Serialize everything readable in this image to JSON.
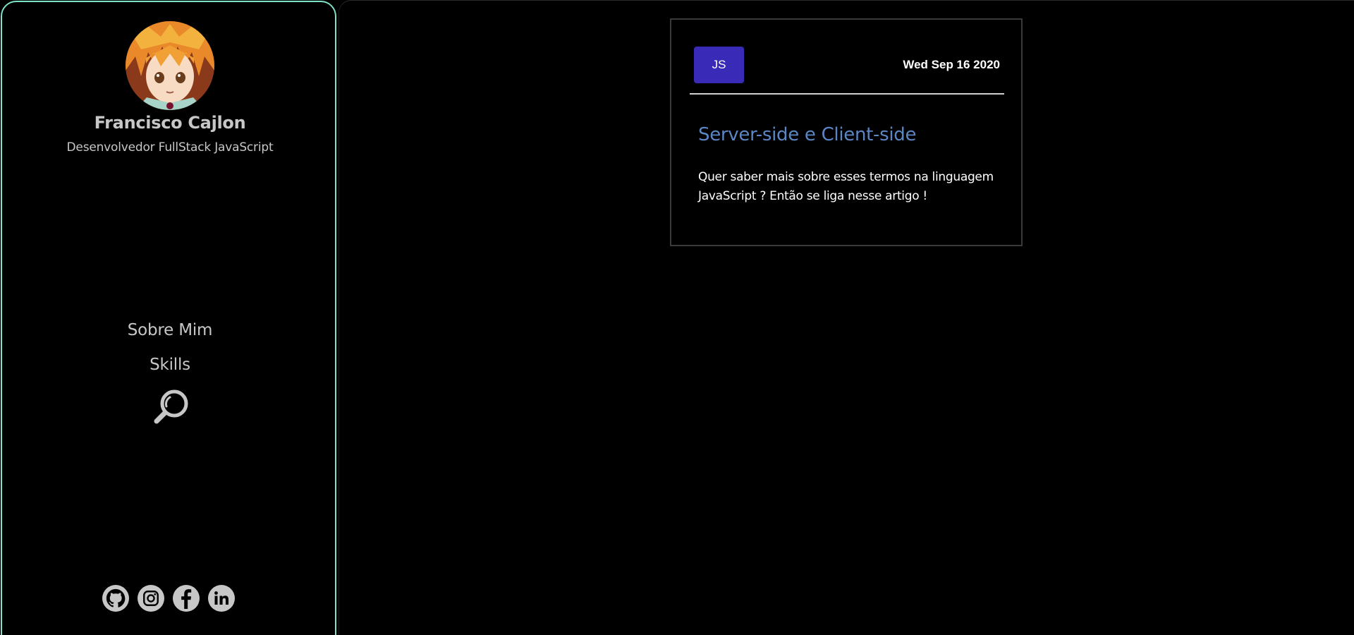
{
  "profile": {
    "name": "Francisco Cajlon",
    "role": "Desenvolvedor FullStack JavaScript"
  },
  "nav": {
    "items": [
      {
        "label": "Sobre Mim"
      },
      {
        "label": "Skills"
      }
    ],
    "search_icon": "search-icon"
  },
  "socials": [
    {
      "icon": "github-icon"
    },
    {
      "icon": "instagram-icon"
    },
    {
      "icon": "facebook-icon"
    },
    {
      "icon": "linkedin-icon"
    }
  ],
  "post": {
    "tag": "JS",
    "date": "Wed Sep 16 2020",
    "title": "Server-side e Client-side",
    "excerpt": "Quer saber mais sobre esses termos na linguagem JavaScript ? Então se liga nesse artigo !"
  },
  "colors": {
    "sidebar_border": "#7de3c8",
    "tag_background": "#3a2ab8",
    "title": "#5b86c4",
    "muted_text": "#c7c7c7"
  }
}
